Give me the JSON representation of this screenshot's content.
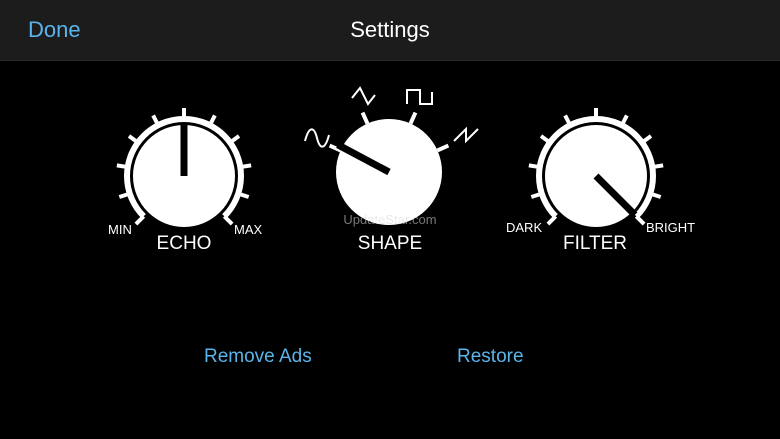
{
  "navbar": {
    "done_label": "Done",
    "title": "Settings"
  },
  "knobs": {
    "echo": {
      "label": "ECHO",
      "min_label": "MIN",
      "max_label": "MAX"
    },
    "shape": {
      "label": "SHAPE",
      "waveforms": [
        "sine",
        "triangle",
        "square",
        "sawtooth"
      ]
    },
    "filter": {
      "label": "FILTER",
      "min_label": "DARK",
      "max_label": "BRIGHT"
    }
  },
  "watermark": "UpdateStar.com",
  "actions": {
    "remove_ads": "Remove Ads",
    "restore": "Restore"
  },
  "colors": {
    "accent": "#5ab4ea",
    "background": "#000000",
    "navbar": "#1c1c1c",
    "knob": "#ffffff"
  }
}
